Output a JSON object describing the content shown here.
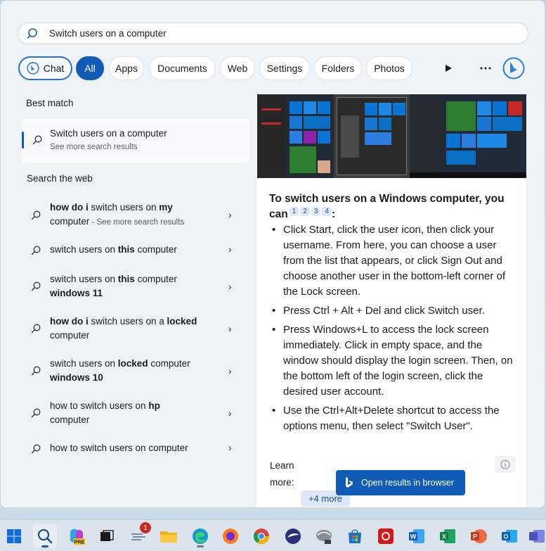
{
  "search": {
    "value": "Switch users on a computer",
    "icon": "search-icon"
  },
  "filters": {
    "chat": "Chat",
    "items": [
      "All",
      "Apps",
      "Documents",
      "Web",
      "Settings",
      "Folders",
      "Photos"
    ],
    "active": "All"
  },
  "best_match": {
    "title": "Best match",
    "item_title": "Switch users on a computer",
    "item_sub": "See more search results"
  },
  "web": {
    "title": "Search the web",
    "items": [
      {
        "pre": "how do i",
        "mid": " switch users on ",
        "bold": "my",
        "line2": "computer",
        "suffix": " - See more search results"
      },
      {
        "pre": "",
        "mid": "switch users on ",
        "bold": "this",
        "line2": " computer",
        "suffix": ""
      },
      {
        "pre": "",
        "mid": "switch users on ",
        "bold": "this",
        "line2": " computer",
        "line3": "windows 11",
        "suffix": ""
      },
      {
        "pre": "how do i",
        "mid": " switch users on a ",
        "bold": "locked",
        "line2": "computer",
        "suffix": ""
      },
      {
        "pre": "",
        "mid": "switch users on ",
        "bold": "locked",
        "line2": " computer",
        "line3": "windows 10",
        "suffix": ""
      },
      {
        "pre": "",
        "mid": "how to switch users on ",
        "bold": "hp",
        "line2": "computer",
        "suffix": ""
      },
      {
        "pre": "",
        "mid": "how to switch users on computer",
        "bold": "",
        "line2": "",
        "suffix": ""
      }
    ]
  },
  "answer": {
    "title": "To switch users on a Windows computer, you can",
    "citations": [
      "1",
      "2",
      "3",
      "4"
    ],
    "bullets": [
      "Click Start, click the user icon, then click your username. From here, you can choose a user from the list that appears, or click Sign Out and choose another user in the bottom-left corner of the Lock screen.",
      "Press Ctrl + Alt + Del and click Switch user.",
      "Press Windows+L to access the lock screen immediately. Click in empty space, and the window should display the login screen. Then, on the bottom left of the login screen, click the desired user account.",
      "Use the Ctrl+Alt+Delete shortcut to access the options menu, then select \"Switch User\"."
    ],
    "learn_more": "Learn more:",
    "more_chip": "+4 more"
  },
  "open_browser": "Open results in browser",
  "taskbar": {
    "badge": "1",
    "icons": [
      "windows-start-icon",
      "search-icon",
      "copilot-pre-icon",
      "task-view-icon",
      "widgets-icon",
      "file-explorer-icon",
      "edge-icon",
      "firefox-icon",
      "chrome-icon",
      "eclipse-icon",
      "cloud-icon",
      "store-icon",
      "acrobat-icon",
      "word-icon",
      "excel-icon",
      "powerpoint-icon",
      "outlook-icon"
    ]
  },
  "colors": {
    "accent": "#0f5bb6",
    "flyout_bg": "#eef3f8"
  }
}
